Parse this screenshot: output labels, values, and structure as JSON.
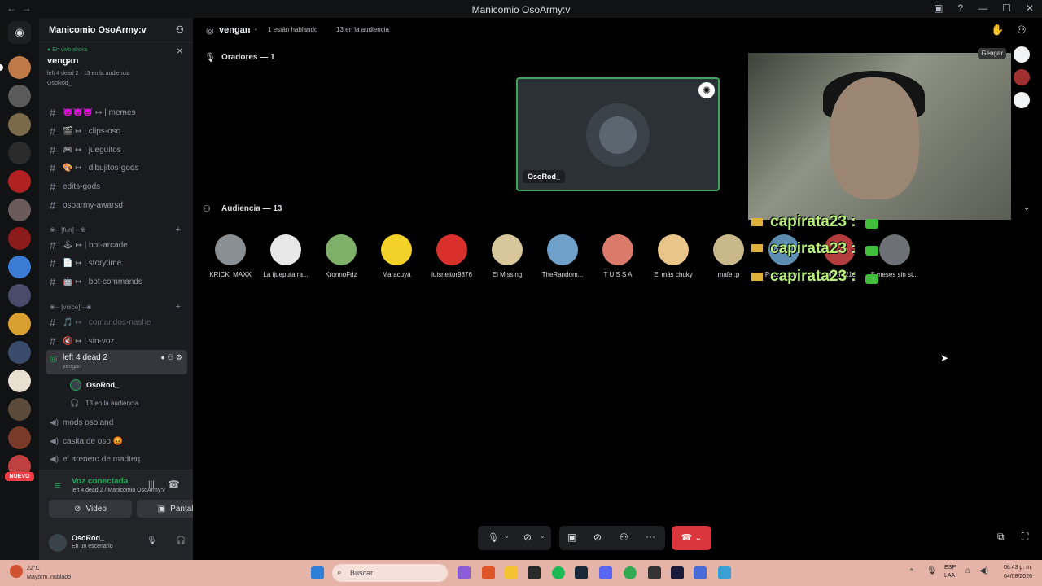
{
  "window": {
    "title": "Manicomio OsoArmy:v"
  },
  "server": {
    "name": "Manicomio OsoArmy:v"
  },
  "live": {
    "tag": "En vivo ahora",
    "title": "vengan",
    "meta": "left 4 dead 2 · 13 en la audiencia",
    "user": "OsoRod_"
  },
  "channels": [
    {
      "type": "text",
      "label": "😈😈😈 ↦ | memes"
    },
    {
      "type": "text",
      "label": "🎬 ↦ | clips-oso"
    },
    {
      "type": "text",
      "label": "🎮 ↦ | jueguitos"
    },
    {
      "type": "text",
      "label": "🎨 ↦ | dibujitos-gods"
    },
    {
      "type": "text",
      "label": "edits-gods"
    },
    {
      "type": "text",
      "label": "osoarmy-awarsd"
    },
    {
      "type": "cat",
      "label": "❀-- [fun] --❀"
    },
    {
      "type": "text",
      "label": "🕹 ↦ | bot-arcade"
    },
    {
      "type": "text",
      "label": "📄 ↦ | storytime"
    },
    {
      "type": "text",
      "label": "🤖 ↦ | bot-commands"
    },
    {
      "type": "cat",
      "label": "❀-- [voice] --❀"
    },
    {
      "type": "text",
      "label": "🎵 ↦ | comandos-nashe",
      "dim": true
    },
    {
      "type": "text",
      "label": "🔇 ↦ | sin-voz"
    }
  ],
  "active_stage": {
    "name": "left 4 dead 2",
    "topic": "vengan",
    "speaker": "OsoRod_",
    "audience": "13 en la audiencia"
  },
  "voice_channels": [
    {
      "label": "mods osoland"
    },
    {
      "label": "casita de oso 😡"
    },
    {
      "label": "el arenero de madteq"
    }
  ],
  "voice_panel": {
    "title": "Voz conectada",
    "sub": "left 4 dead 2 / Manicomio OsoArmy:v",
    "video": "Video",
    "screen": "Pantalla"
  },
  "user": {
    "name": "OsoRod_",
    "status": "En un escenario"
  },
  "topbar": {
    "channel": "vengan",
    "speaking": "1 están hablando",
    "audience": "13 en la audiencia"
  },
  "speakers": {
    "title": "Oradores — 1",
    "name": "OsoRod_"
  },
  "audience": {
    "title": "Audiencia — 13",
    "members": [
      {
        "name": "KRICK_MAXX",
        "color": "#8a8f94"
      },
      {
        "name": "La ijueputa ra...",
        "color": "#e8e8e8"
      },
      {
        "name": "KronnoFdz",
        "color": "#7fb069"
      },
      {
        "name": "Maracuyá",
        "color": "#f2d129"
      },
      {
        "name": "luisneitor9876",
        "color": "#d9302c"
      },
      {
        "name": "El Missing",
        "color": "#d8c79a"
      },
      {
        "name": "TheRandom...",
        "color": "#6fa0c9"
      },
      {
        "name": "T U S S A",
        "color": "#d97a6b"
      },
      {
        "name": "El más chuky",
        "color": "#e9c58a"
      },
      {
        "name": "mafe :p",
        "color": "#c9b88a"
      },
      {
        "name": "Pezzito:/ba...",
        "color": "#5d8db0"
      },
      {
        "name": "gamer1210",
        "color": "#b33c3c"
      },
      {
        "name": "5 meses sin st...",
        "color": "#6d7075"
      }
    ]
  },
  "overlay": {
    "text": "capirata23 :"
  },
  "taskbar": {
    "search": "Buscar",
    "weather_temp": "22°C",
    "weather_desc": "Mayorm. nublado",
    "lang": "ESP LAA",
    "time": "08:43 p. m.",
    "date": "04/08/2026"
  },
  "badge": "NUEVO",
  "camera_label": "Gengar"
}
